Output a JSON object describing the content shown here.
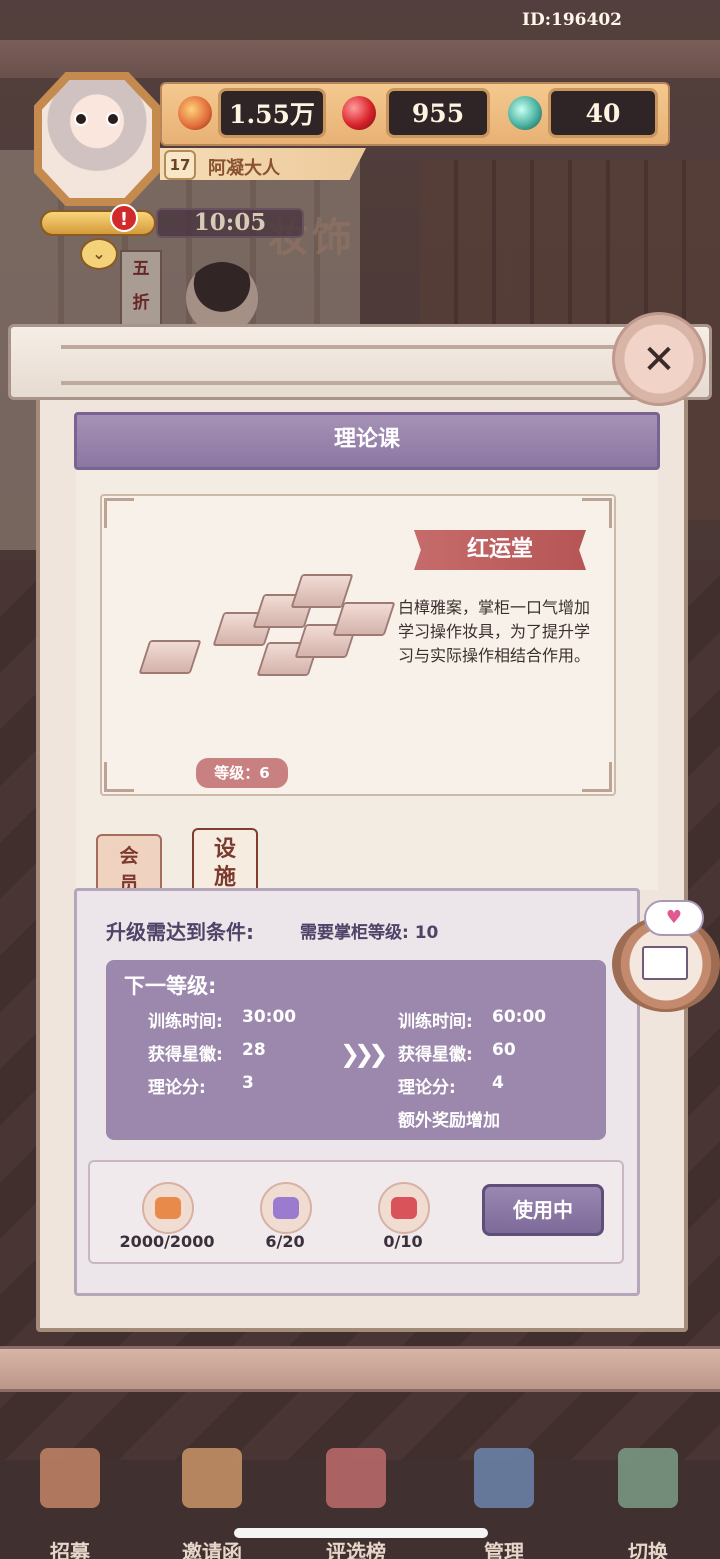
{
  "status": {
    "player_id": "ID:196402"
  },
  "resources": [
    {
      "icon": "peach-coin-icon",
      "value": "1.55万"
    },
    {
      "icon": "red-gem-icon",
      "value": "955"
    },
    {
      "icon": "jade-orb-icon",
      "value": "40"
    }
  ],
  "player": {
    "level": "17",
    "name": "阿凝大人",
    "timer": "10:05",
    "alert": "!"
  },
  "background": {
    "shop_sign": "妆饰",
    "poster": [
      "五",
      "折"
    ]
  },
  "modal": {
    "title": "理论课",
    "close_label": "✕",
    "facility": {
      "name": "红运堂",
      "description": "白樟雅案，掌柜一口气增加学习操作妆具，为了提升学习与实际操作相结合作用。",
      "level_label": "等级：6"
    },
    "tabs": [
      {
        "label_lines": [
          "会",
          "员"
        ]
      },
      {
        "label_lines": [
          "设",
          "施"
        ]
      }
    ],
    "requirement": {
      "label": "升级需达到条件:",
      "value": "需要掌柜等级: 10"
    },
    "next_level": {
      "title": "下一等级:",
      "current": [
        {
          "label": "训练时间:",
          "value": "30:00"
        },
        {
          "label": "获得星徽:",
          "value": "28"
        },
        {
          "label": "理论分:",
          "value": "3"
        }
      ],
      "next": [
        {
          "label": "训练时间:",
          "value": "60:00"
        },
        {
          "label": "获得星徽:",
          "value": "60"
        },
        {
          "label": "理论分:",
          "value": "4"
        }
      ],
      "extra": "额外奖励增加"
    },
    "costs": [
      {
        "icon": "heart-peach-icon",
        "amount": "2000/2000",
        "color": "#e88a4a"
      },
      {
        "icon": "purple-ingot-icon",
        "amount": "6/20",
        "color": "#9b7bd0"
      },
      {
        "icon": "red-ingot-icon",
        "amount": "0/10",
        "color": "#d9545a"
      }
    ],
    "use_button": "使用中"
  },
  "bottom_nav": [
    {
      "label": "招募",
      "color": "#c98a6a"
    },
    {
      "label": "邀请函",
      "color": "#d19b6c"
    },
    {
      "label": "评选榜",
      "color": "#c46f6f"
    },
    {
      "label": "管理",
      "color": "#6f8bb5"
    },
    {
      "label": "切换",
      "color": "#7fa48c"
    }
  ]
}
